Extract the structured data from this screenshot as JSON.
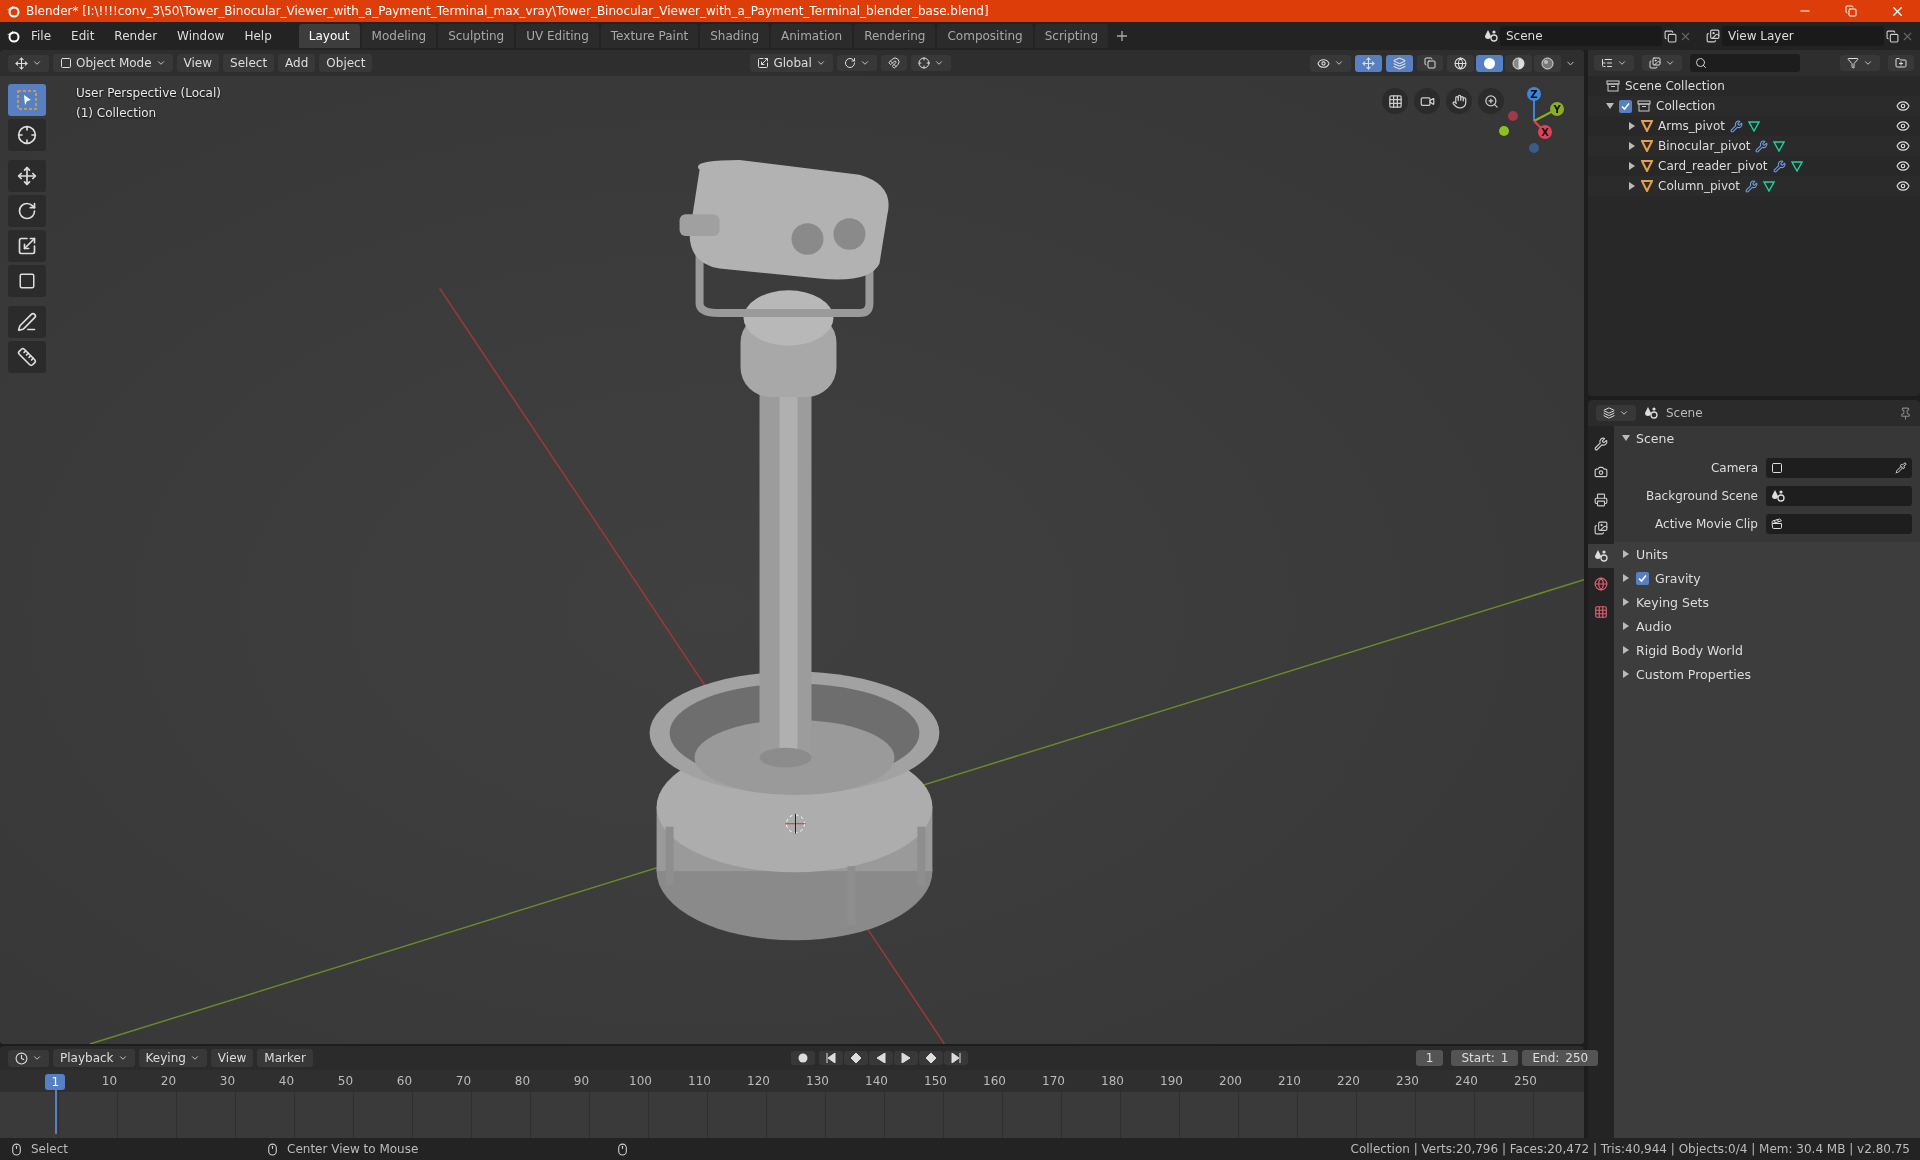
{
  "window": {
    "title": "Blender* [I:\\!!!!conv_3\\50\\Tower_Binocular_Viewer_with_a_Payment_Terminal_max_vray\\Tower_Binocular_Viewer_with_a_Payment_Terminal_blender_base.blend]"
  },
  "menu": [
    "File",
    "Edit",
    "Render",
    "Window",
    "Help"
  ],
  "workspaces": [
    {
      "label": "Layout",
      "selected": true
    },
    {
      "label": "Modeling",
      "selected": false
    },
    {
      "label": "Sculpting",
      "selected": false
    },
    {
      "label": "UV Editing",
      "selected": false
    },
    {
      "label": "Texture Paint",
      "selected": false
    },
    {
      "label": "Shading",
      "selected": false
    },
    {
      "label": "Animation",
      "selected": false
    },
    {
      "label": "Rendering",
      "selected": false
    },
    {
      "label": "Compositing",
      "selected": false
    },
    {
      "label": "Scripting",
      "selected": false
    }
  ],
  "scene_field": {
    "value": "Scene"
  },
  "view_layer_field": {
    "value": "View Layer"
  },
  "viewport": {
    "mode": "Object Mode",
    "menus": [
      "View",
      "Select",
      "Add",
      "Object"
    ],
    "orientation": "Global",
    "overlay": [
      "User Perspective (Local)",
      "(1) Collection"
    ],
    "gizmo": [
      "Z",
      "Y",
      "X"
    ],
    "tools": [
      {
        "kind": "select",
        "selected": true
      },
      {
        "kind": "cursor",
        "selected": false
      },
      {
        "kind": "move",
        "selected": false
      },
      {
        "kind": "rotate",
        "selected": false
      },
      {
        "kind": "scale",
        "selected": false
      },
      {
        "kind": "transform",
        "selected": false
      },
      {
        "kind": "annotate",
        "selected": false
      },
      {
        "kind": "measure",
        "selected": false
      }
    ],
    "shading": [
      {
        "kind": "wireframe",
        "selected": false
      },
      {
        "kind": "solid",
        "selected": true
      },
      {
        "kind": "material",
        "selected": false
      },
      {
        "kind": "rendered",
        "selected": false
      }
    ]
  },
  "outliner": {
    "root": "Scene Collection",
    "tree": [
      {
        "label": "Collection",
        "checked": true,
        "expanded": true,
        "children": [
          {
            "label": "Arms_pivot",
            "expanded": false
          },
          {
            "label": "Binocular_pivot",
            "expanded": false
          },
          {
            "label": "Card_reader_pivot",
            "expanded": false
          },
          {
            "label": "Column_pivot",
            "expanded": false
          }
        ]
      }
    ]
  },
  "properties": {
    "title": "Scene",
    "tabs": [
      {
        "kind": "tool",
        "selected": false
      },
      {
        "kind": "render",
        "selected": false
      },
      {
        "kind": "output",
        "selected": false
      },
      {
        "kind": "view_layer",
        "selected": false
      },
      {
        "kind": "scene",
        "selected": true
      },
      {
        "kind": "world",
        "selected": false
      },
      {
        "kind": "texture",
        "selected": false
      }
    ],
    "panel": {
      "title": "Scene",
      "expanded": true,
      "fields": [
        {
          "label": "Camera",
          "kind": "camera"
        },
        {
          "label": "Background Scene",
          "kind": "scene"
        },
        {
          "label": "Active Movie Clip",
          "kind": "clip"
        }
      ]
    },
    "sections": [
      {
        "label": "Units",
        "expanded": false
      },
      {
        "label": "Gravity",
        "expanded": false,
        "checked": true
      },
      {
        "label": "Keying Sets",
        "expanded": false
      },
      {
        "label": "Audio",
        "expanded": false
      },
      {
        "label": "Rigid Body World",
        "expanded": false
      },
      {
        "label": "Custom Properties",
        "expanded": false
      }
    ]
  },
  "timeline": {
    "menus": [
      "Playback",
      "Keying",
      "View",
      "Marker"
    ],
    "current_frame": "1",
    "start_label": "Start:",
    "start": "1",
    "end_label": "End:",
    "end": "250",
    "playhead": "1",
    "ticks": [
      "10",
      "20",
      "30",
      "40",
      "50",
      "60",
      "70",
      "80",
      "90",
      "100",
      "110",
      "120",
      "130",
      "140",
      "150",
      "160",
      "170",
      "180",
      "190",
      "200",
      "210",
      "220",
      "230",
      "240",
      "250"
    ]
  },
  "status_bar": {
    "hints": [
      "Select",
      "Center View to Mouse"
    ],
    "stats": "Collection | Verts:20,796 | Faces:20,472 | Tris:40,944 | Objects:0/4 | Mem: 30.4 MB | v2.80.75"
  }
}
